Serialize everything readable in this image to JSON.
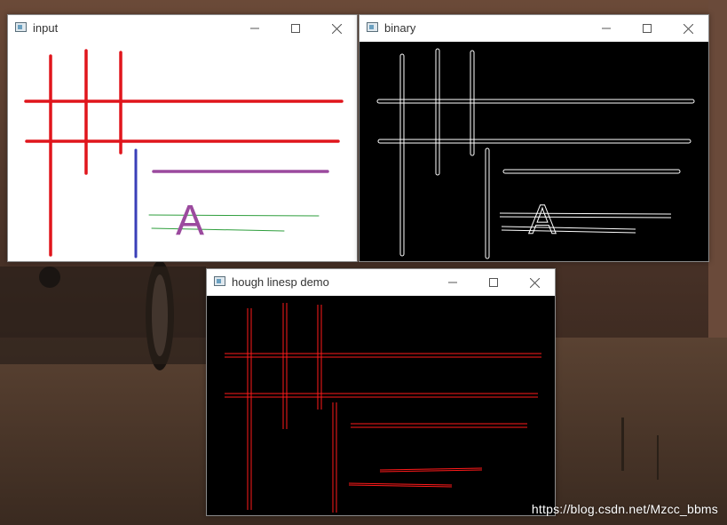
{
  "windows": {
    "input": {
      "title": "input"
    },
    "binary": {
      "title": "binary"
    },
    "hough": {
      "title": "hough linesp demo"
    }
  },
  "input_image": {
    "glyph": "A"
  },
  "binary_image": {
    "glyph": "A"
  },
  "window_controls": {
    "minimize_icon": "minimize-icon",
    "maximize_icon": "maximize-icon",
    "close_icon": "close-icon"
  },
  "watermark": "https://blog.csdn.net/Mzcc_bbms",
  "colors": {
    "red": "#e0151c",
    "blue": "#3a3fb8",
    "purple": "#9b4a9e",
    "green": "#2e9e3c",
    "hough_red": "#ff1a1a"
  }
}
